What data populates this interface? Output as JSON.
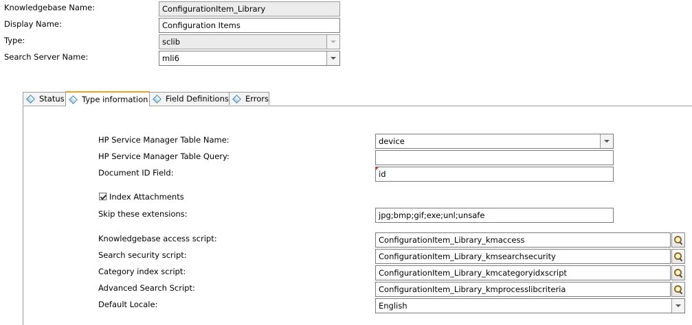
{
  "header": {
    "kb_name_label": "Knowledgebase Name:",
    "kb_name_value": "ConfigurationItem_Library",
    "display_name_label": "Display Name:",
    "display_name_value": "Configuration Items",
    "type_label": "Type:",
    "type_value": "sclib",
    "search_server_label": "Search Server Name:",
    "search_server_value": "mli6"
  },
  "tabs": [
    {
      "label": "Status"
    },
    {
      "label": "Type information"
    },
    {
      "label": "Field Definitions"
    },
    {
      "label": "Errors"
    }
  ],
  "type_info": {
    "table_name_label": "HP Service Manager Table Name:",
    "table_name_value": "device",
    "table_query_label": "HP Service Manager Table Query:",
    "table_query_value": "",
    "doc_id_label": "Document ID Field:",
    "doc_id_value": "id",
    "index_attachments_label": "Index Attachments",
    "skip_ext_label": "Skip these extensions:",
    "skip_ext_value": "jpg;bmp;gif;exe;unl;unsafe",
    "kb_access_label": "Knowledgebase access script:",
    "kb_access_value": "ConfigurationItem_Library_kmaccess",
    "search_security_label": "Search security script:",
    "search_security_value": "ConfigurationItem_Library_kmsearchsecurity",
    "category_index_label": "Category index script:",
    "category_index_value": "ConfigurationItem_Library_kmcategoryidxscript",
    "advanced_search_label": "Advanced Search Script:",
    "advanced_search_value": "ConfigurationItem_Library_kmprocesslibcriteria",
    "default_locale_label": "Default Locale:",
    "default_locale_value": "English"
  }
}
